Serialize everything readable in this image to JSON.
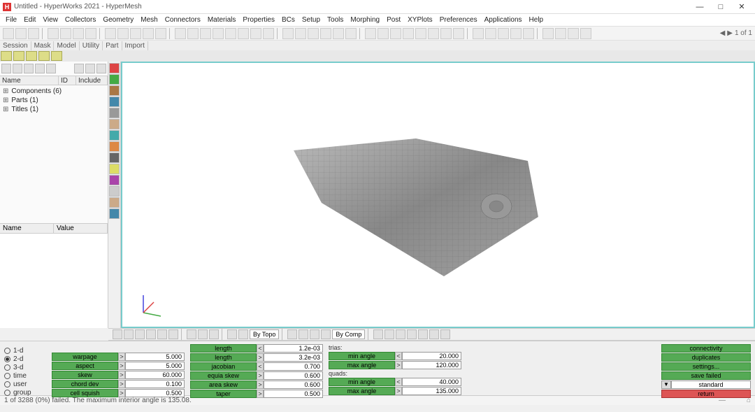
{
  "title": "Untitled - HyperWorks 2021 - HyperMesh",
  "menu": [
    "File",
    "Edit",
    "View",
    "Collectors",
    "Geometry",
    "Mesh",
    "Connectors",
    "Materials",
    "Properties",
    "BCs",
    "Setup",
    "Tools",
    "Morphing",
    "Post",
    "XYPlots",
    "Preferences",
    "Applications",
    "Help"
  ],
  "tabs_left": [
    "Session",
    "Mask",
    "Model",
    "Utility",
    "Part",
    "Import"
  ],
  "tree_cols": {
    "name": "Name",
    "id": "ID",
    "inc": "Include"
  },
  "tree": [
    {
      "label": "Components (6)"
    },
    {
      "label": "Parts (1)"
    },
    {
      "label": "Titles (1)"
    }
  ],
  "props_cols": {
    "name": "Name",
    "value": "Value"
  },
  "btm_sel_topo": "By Topo",
  "btm_sel_comp": "By Comp",
  "page_counter": "1 of 1",
  "radios": {
    "d1": "1-d",
    "d2": "2-d",
    "d3": "3-d",
    "time": "time",
    "user": "user",
    "group": "group"
  },
  "g1": [
    {
      "label": "warpage",
      "sym": ">",
      "val": "5.000"
    },
    {
      "label": "aspect",
      "sym": ">",
      "val": "5.000"
    },
    {
      "label": "skew",
      "sym": ">",
      "val": "60.000"
    },
    {
      "label": "chord dev",
      "sym": ">",
      "val": "0.100"
    },
    {
      "label": "cell squish",
      "sym": ">",
      "val": "0.500"
    }
  ],
  "g2": [
    {
      "label": "length",
      "sym": "<",
      "val": "1.2e-03"
    },
    {
      "label": "length",
      "sym": ">",
      "val": "3.2e-03"
    },
    {
      "label": "jacobian",
      "sym": "<",
      "val": "0.700"
    },
    {
      "label": "equia skew",
      "sym": ">",
      "val": "0.600"
    },
    {
      "label": "area skew",
      "sym": ">",
      "val": "0.600"
    },
    {
      "label": "taper",
      "sym": ">",
      "val": "0.500"
    }
  ],
  "trias_caption": "trias:",
  "trias": [
    {
      "label": "min angle",
      "sym": "<",
      "val": "20.000"
    },
    {
      "label": "max angle",
      "sym": ">",
      "val": "120.000"
    }
  ],
  "quads_caption": "quads:",
  "quads": [
    {
      "label": "min angle",
      "sym": "<",
      "val": "40.000"
    },
    {
      "label": "max angle",
      "sym": ">",
      "val": "135.000"
    }
  ],
  "actions": {
    "connectivity": "connectivity",
    "duplicates": "duplicates",
    "settings": "settings...",
    "save_failed": "save failed",
    "standard": "standard",
    "return": "return"
  },
  "status": "1 of 3288 (0%) failed.  The maximum interior angle is 135.08.",
  "icons": {
    "h": "H"
  }
}
